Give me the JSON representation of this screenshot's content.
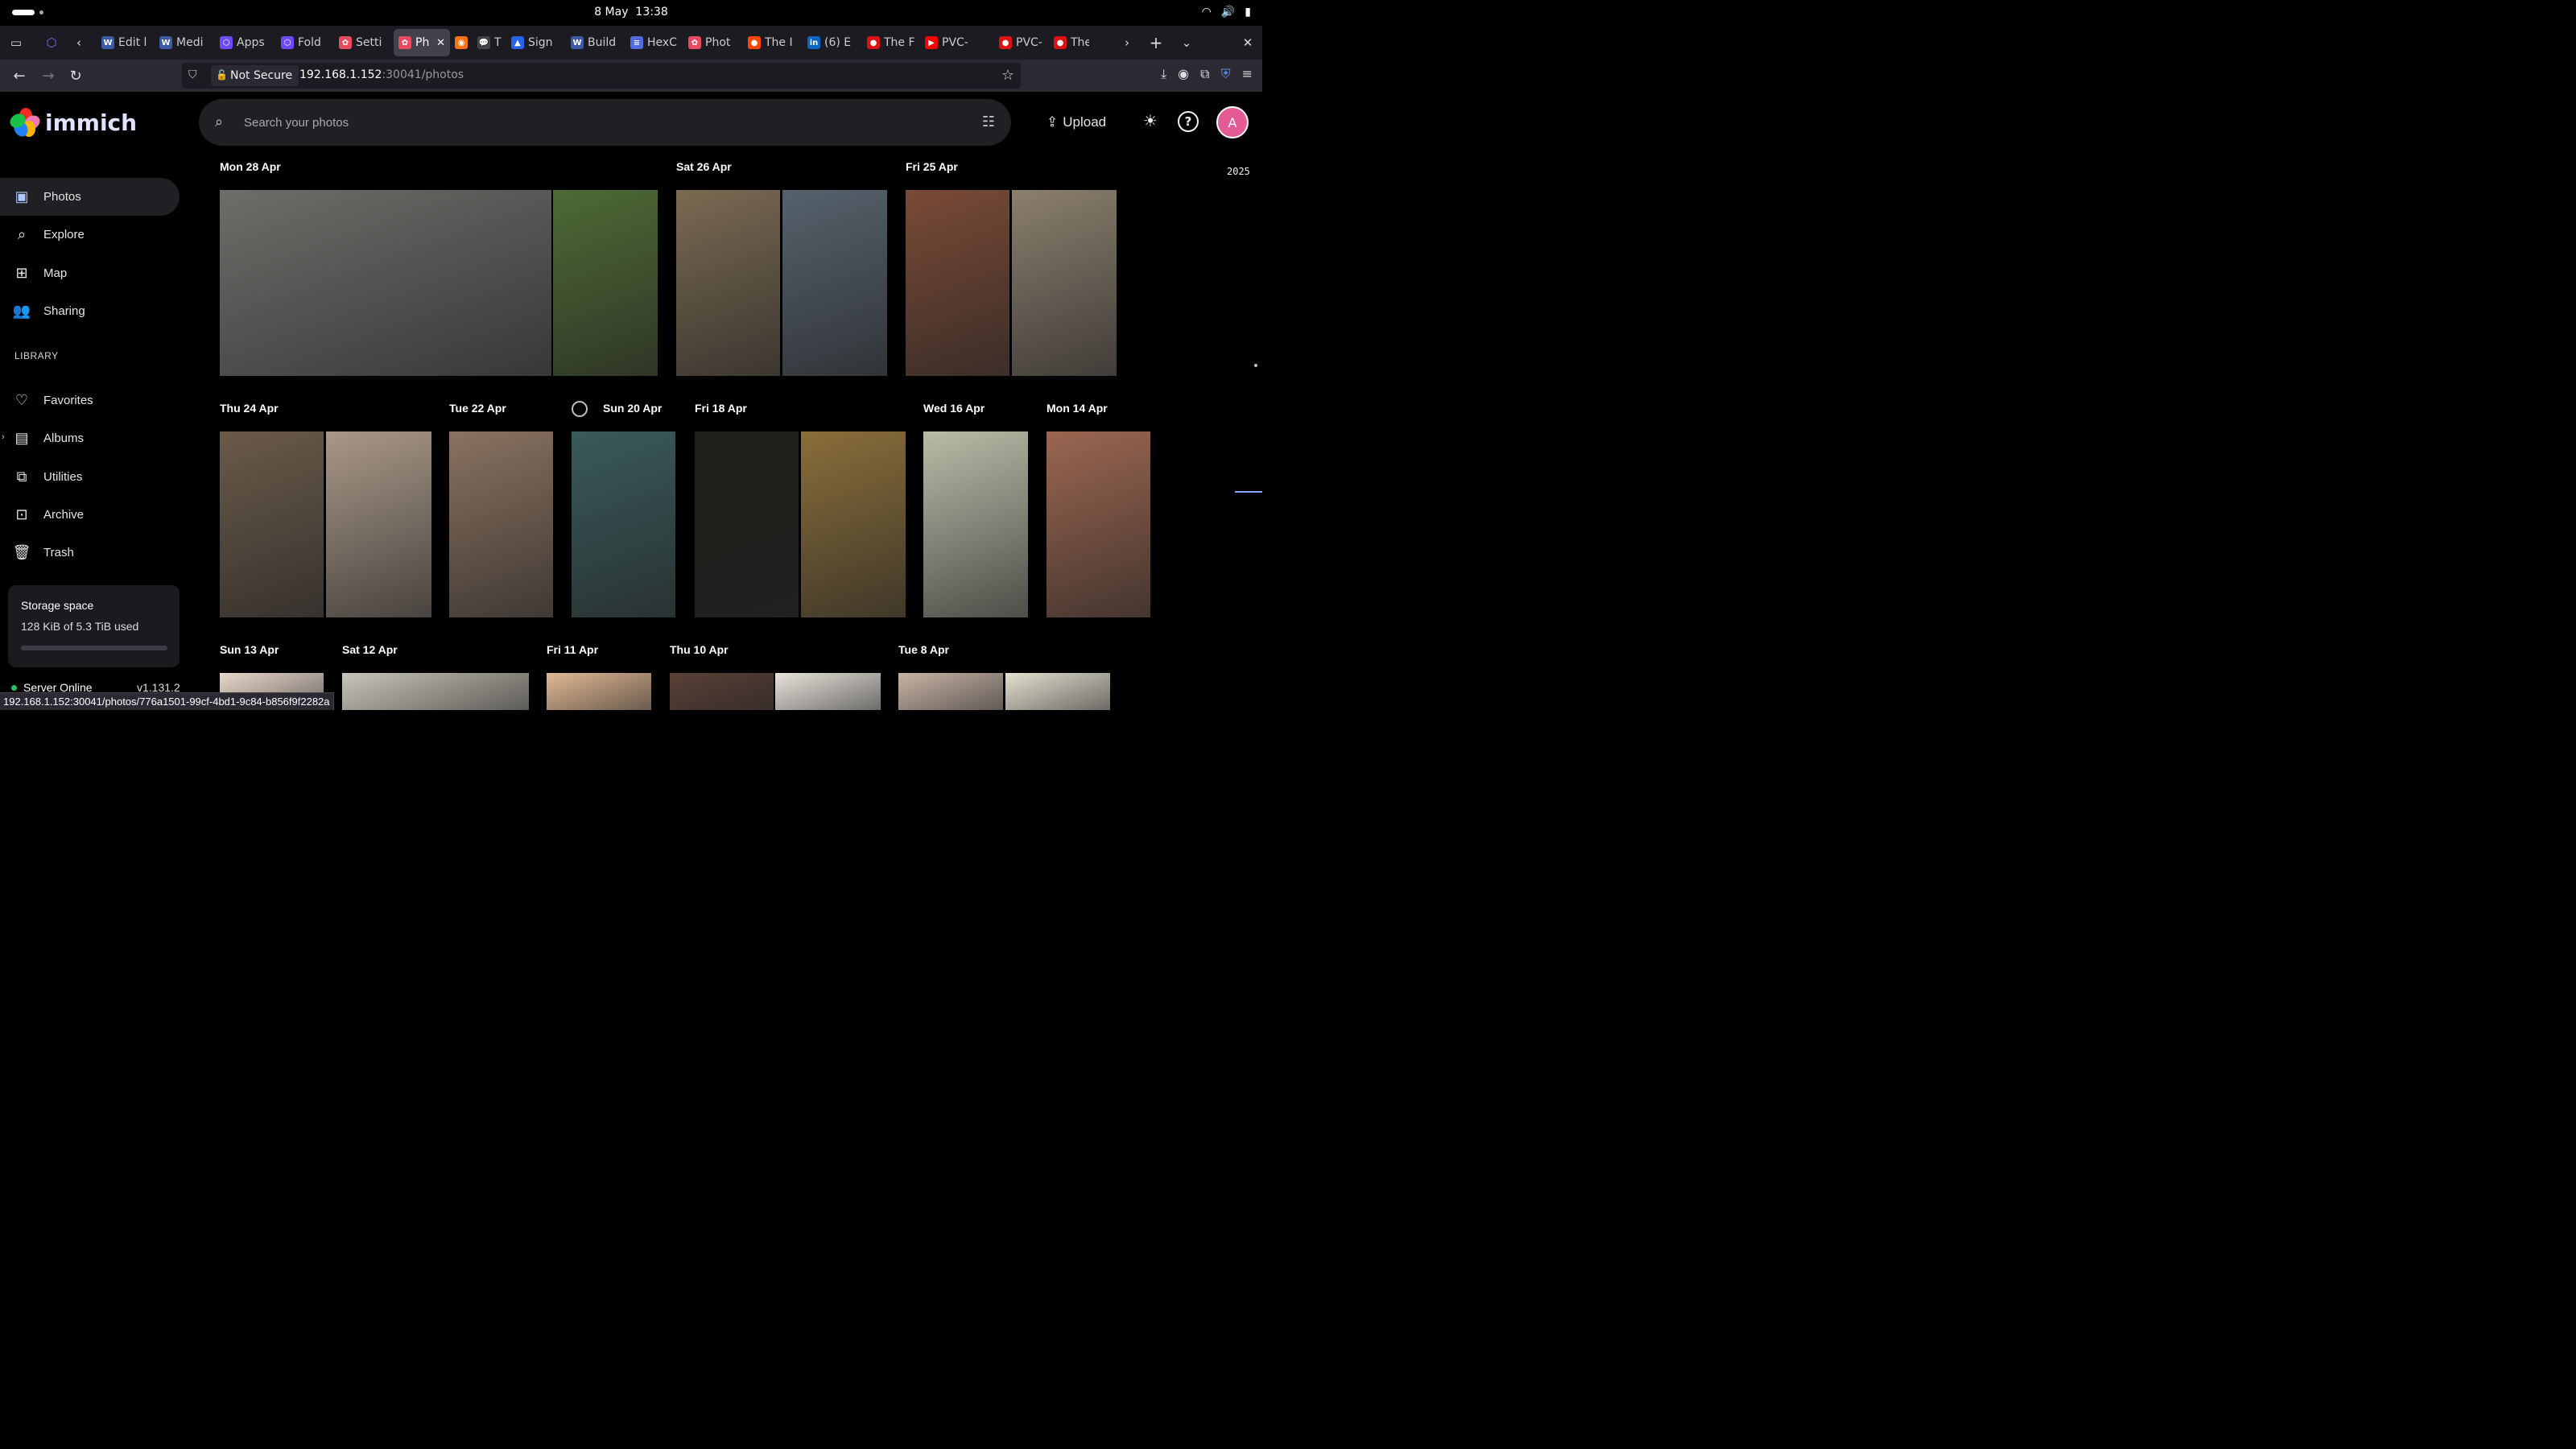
{
  "system": {
    "date": "8 May",
    "time": "13:38"
  },
  "browser": {
    "tabs": [
      {
        "title": "Edit l",
        "color": "#3b5ba5",
        "glyph": "W"
      },
      {
        "title": "Medi",
        "color": "#3b5ba5",
        "glyph": "W"
      },
      {
        "title": "Apps",
        "color": "#6d4aff",
        "glyph": "⬡"
      },
      {
        "title": "Fold",
        "color": "#6d4aff",
        "glyph": "⬡"
      },
      {
        "title": "Setti",
        "color": "#e84a5f",
        "glyph": "✿"
      },
      {
        "title": "Ph",
        "color": "#e84a5f",
        "glyph": "✿",
        "active": true
      },
      {
        "title": "",
        "color": "#f97316",
        "glyph": "◉"
      },
      {
        "title": "Ti",
        "color": "#444",
        "glyph": "💬"
      },
      {
        "title": "Sign",
        "color": "#2563eb",
        "glyph": "▲"
      },
      {
        "title": "Build",
        "color": "#3b5ba5",
        "glyph": "W"
      },
      {
        "title": "HexC",
        "color": "#4f6bdc",
        "glyph": "≡"
      },
      {
        "title": "Phot",
        "color": "#e84a5f",
        "glyph": "✿"
      },
      {
        "title": "The I",
        "color": "#ff4500",
        "glyph": "●"
      },
      {
        "title": "(6) E",
        "color": "#0a66c2",
        "glyph": "in"
      },
      {
        "title": "The F",
        "color": "#d11",
        "glyph": "●"
      },
      {
        "title": "PVC-",
        "color": "#f00",
        "glyph": "▶"
      },
      {
        "title": "PVC-",
        "color": "#d11",
        "glyph": "●"
      },
      {
        "title": "The",
        "color": "#d11",
        "glyph": "●"
      }
    ],
    "url_security": "Not Secure",
    "url_host": "192.168.1.152",
    "url_rest": ":30041/photos",
    "status_url": "192.168.1.152:30041/photos/776a1501-99cf-4bd1-9c84-b856f9f2282a"
  },
  "app": {
    "name": "immich",
    "search_placeholder": "Search your photos",
    "upload_label": "Upload",
    "avatar_initial": "A",
    "year": "2025"
  },
  "sidebar": {
    "items": [
      {
        "label": "Photos",
        "icon": "photos-icon",
        "glyph": "▣",
        "active": true
      },
      {
        "label": "Explore",
        "icon": "search-icon",
        "glyph": "⌕"
      },
      {
        "label": "Map",
        "icon": "map-icon",
        "glyph": "⊞"
      },
      {
        "label": "Sharing",
        "icon": "people-icon",
        "glyph": "👥"
      }
    ],
    "library_heading": "LIBRARY",
    "library_items": [
      {
        "label": "Favorites",
        "icon": "heart-icon",
        "glyph": "♡"
      },
      {
        "label": "Albums",
        "icon": "album-icon",
        "glyph": "▤"
      },
      {
        "label": "Utilities",
        "icon": "toolbox-icon",
        "glyph": "⧉"
      },
      {
        "label": "Archive",
        "icon": "archive-icon",
        "glyph": "⊡"
      },
      {
        "label": "Trash",
        "icon": "trash-icon",
        "glyph": "🗑"
      }
    ],
    "storage_title": "Storage space",
    "storage_used": "128 KiB of 5.3 TiB used",
    "storage_fraction": 0.0,
    "server_status": "Server Online",
    "version": "v1.131.2"
  },
  "timeline": {
    "groups": [
      {
        "date": "Mon 28 Apr",
        "photos": [
          {
            "bg": "#6d6d6a"
          },
          {
            "bg": "#4e6a34"
          }
        ]
      },
      {
        "date": "Sat 26 Apr",
        "photos": [
          {
            "bg": "#7a6a52"
          },
          {
            "bg": "#55626d"
          }
        ]
      },
      {
        "date": "Fri 25 Apr",
        "photos": [
          {
            "bg": "#7a4a36"
          },
          {
            "bg": "#8b7f6e"
          }
        ]
      },
      {
        "date": "Thu 24 Apr",
        "photos": [
          {
            "bg": "#6a5a4a"
          },
          {
            "bg": "#a99888"
          }
        ]
      },
      {
        "date": "Tue 22 Apr",
        "photos": [
          {
            "bg": "#8a7260"
          }
        ]
      },
      {
        "date": "Sun 20 Apr",
        "photos": [
          {
            "bg": "#3a5a5a"
          }
        ]
      },
      {
        "date": "Fri 18 Apr",
        "photos": [
          {
            "bg": "#1e1f1a"
          },
          {
            "bg": "#8a6e3a"
          }
        ]
      },
      {
        "date": "Wed 16 Apr",
        "photos": [
          {
            "bg": "#b8bda8"
          }
        ]
      },
      {
        "date": "Mon 14 Apr",
        "photos": [
          {
            "bg": "#9b6650"
          }
        ]
      },
      {
        "date": "Sun 13 Apr",
        "photos": [
          {
            "bg": "#e9d8cc"
          }
        ]
      },
      {
        "date": "Sat 12 Apr",
        "photos": [
          {
            "bg": "#c9c4b8"
          }
        ]
      },
      {
        "date": "Fri 11 Apr",
        "photos": [
          {
            "bg": "#e0b893"
          }
        ]
      },
      {
        "date": "Thu 10 Apr",
        "photos": [
          {
            "bg": "#5a4036"
          },
          {
            "bg": "#e8e4dc"
          }
        ]
      },
      {
        "date": "Tue 8 Apr",
        "photos": [
          {
            "bg": "#c8b4a6"
          },
          {
            "bg": "#e4e0d0"
          }
        ]
      }
    ]
  }
}
